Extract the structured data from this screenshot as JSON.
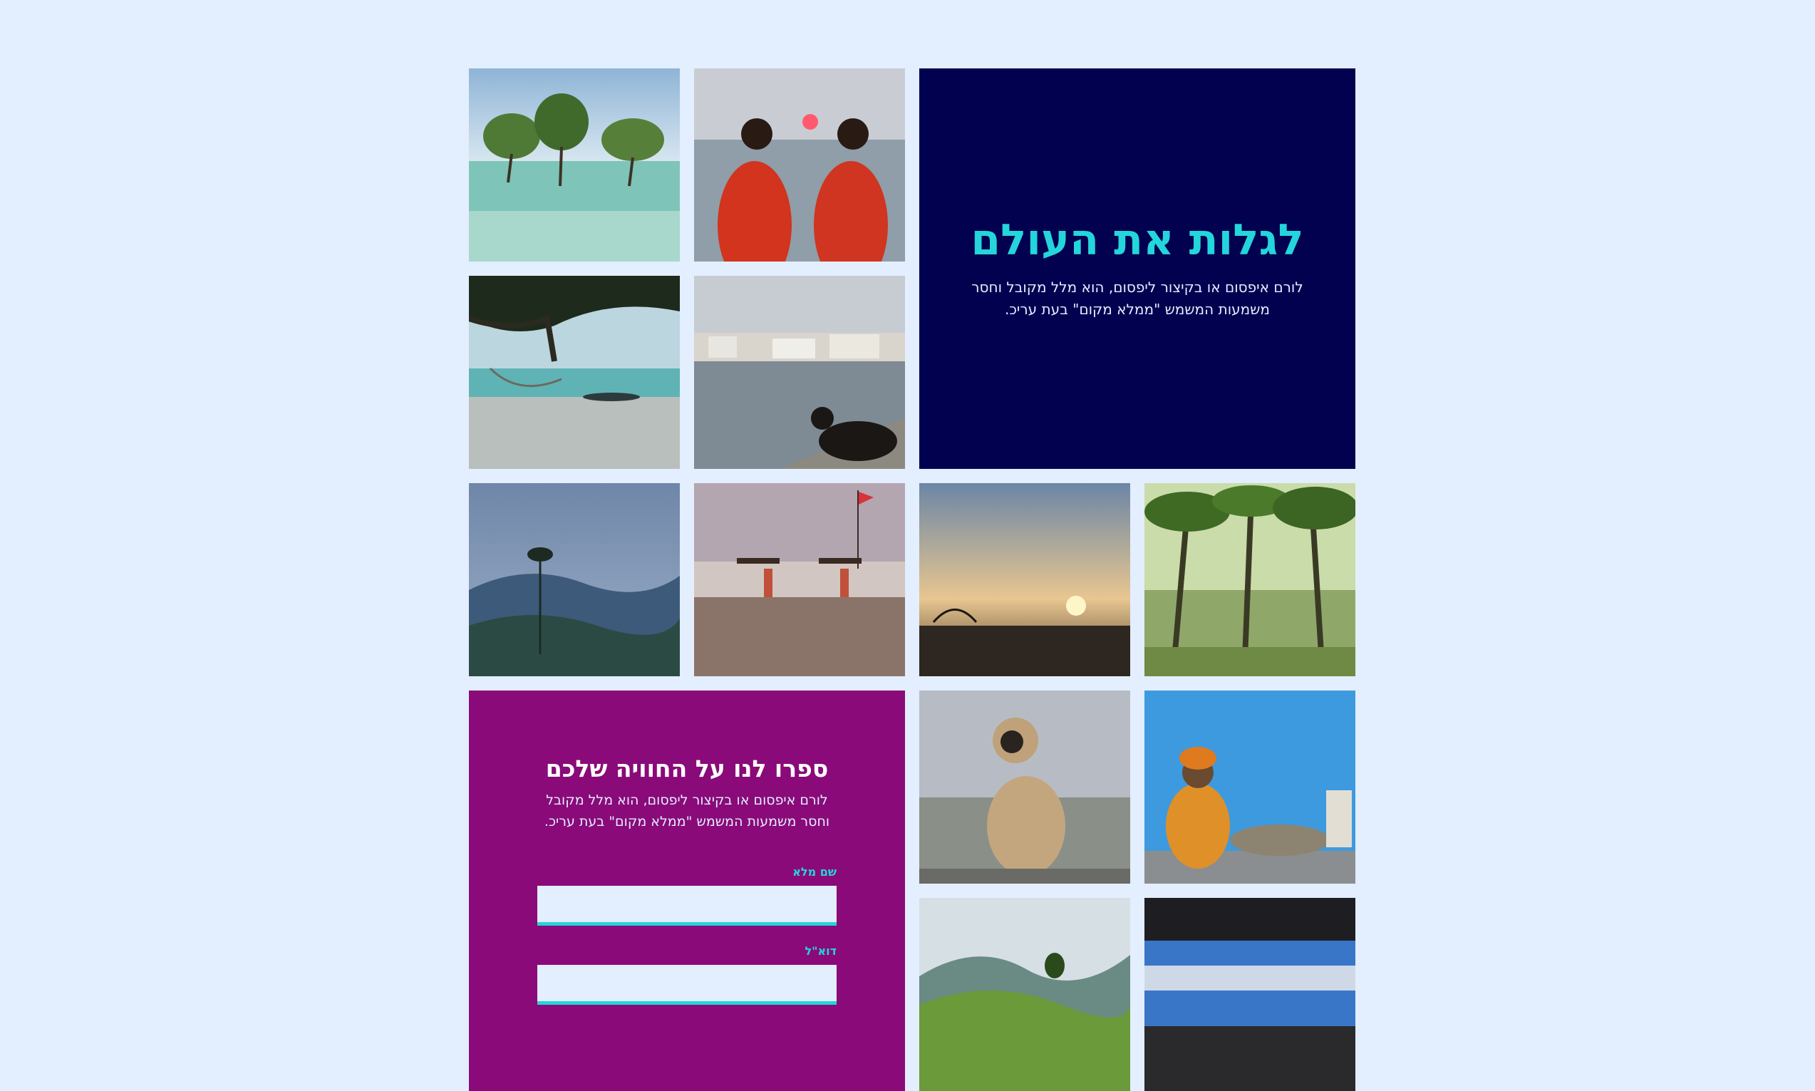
{
  "hero": {
    "title": "לגלות את העולם",
    "text": "לורם איפסום או בקיצור ליפסום, הוא מלל מקובל וחסר משמעות המשמש \"ממלא מקום\" בעת עריכ."
  },
  "form": {
    "title": "ספרו לנו על החוויה שלכם",
    "text": "לורם איפסום או בקיצור ליפסום, הוא מלל מקובל וחסר משמעות המשמש \"ממלא מקום\" בעת עריכ.",
    "fields": [
      {
        "label": "שם מלא",
        "value": ""
      },
      {
        "label": "דוא\"ל",
        "value": ""
      }
    ]
  },
  "colors": {
    "page_bg": "#e3eeff",
    "hero_bg": "#010150",
    "accent": "#24d5dc",
    "form_bg": "#8a0a79"
  }
}
